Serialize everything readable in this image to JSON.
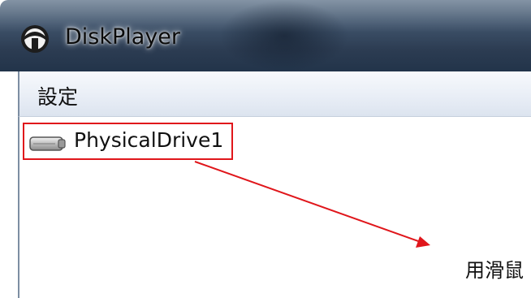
{
  "window": {
    "title": "DiskPlayer",
    "icon": "app-icon"
  },
  "menu": {
    "settings_label": "設定"
  },
  "drives": [
    {
      "label": "PhysicalDrive1",
      "icon": "hard-drive-icon"
    }
  ],
  "annotation": {
    "text": "用滑鼠",
    "color": "#e0161b"
  }
}
